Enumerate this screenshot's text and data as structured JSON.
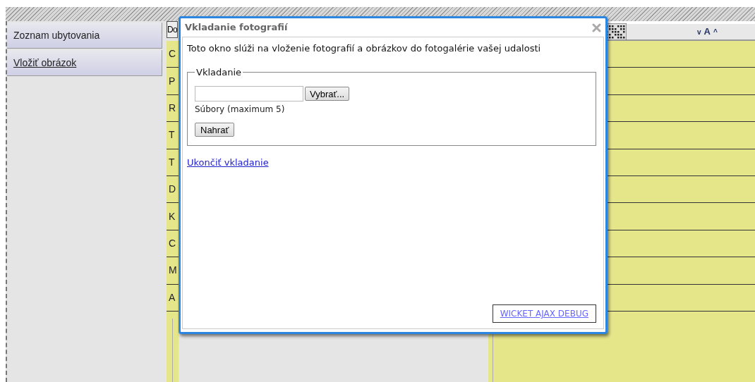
{
  "sidebar": {
    "items": [
      {
        "label": "Zoznam ubytovania",
        "kind": "plain"
      },
      {
        "label": "Vložiť obrázok",
        "kind": "link"
      }
    ]
  },
  "list": {
    "header": "Do",
    "cells": [
      "C",
      "P",
      "R",
      "T",
      "T",
      "D",
      "K",
      "C",
      "M",
      "A"
    ]
  },
  "toolbar": {
    "font_controls": [
      "v",
      "A",
      "^"
    ]
  },
  "dialog": {
    "title": "Vkladanie fotografií",
    "description": "Toto okno slúži na vloženie fotografií a obrázkov do fotogalérie vašej udalosti",
    "fieldset": {
      "legend": "Vkladanie",
      "browse_button": "Vybrať...",
      "hint": "Súbory (maximum 5)",
      "upload_button": "Nahrať"
    },
    "finish_link": "Ukončiť vkladanie",
    "debug_link": "WICKET AJAX DEBUG"
  }
}
